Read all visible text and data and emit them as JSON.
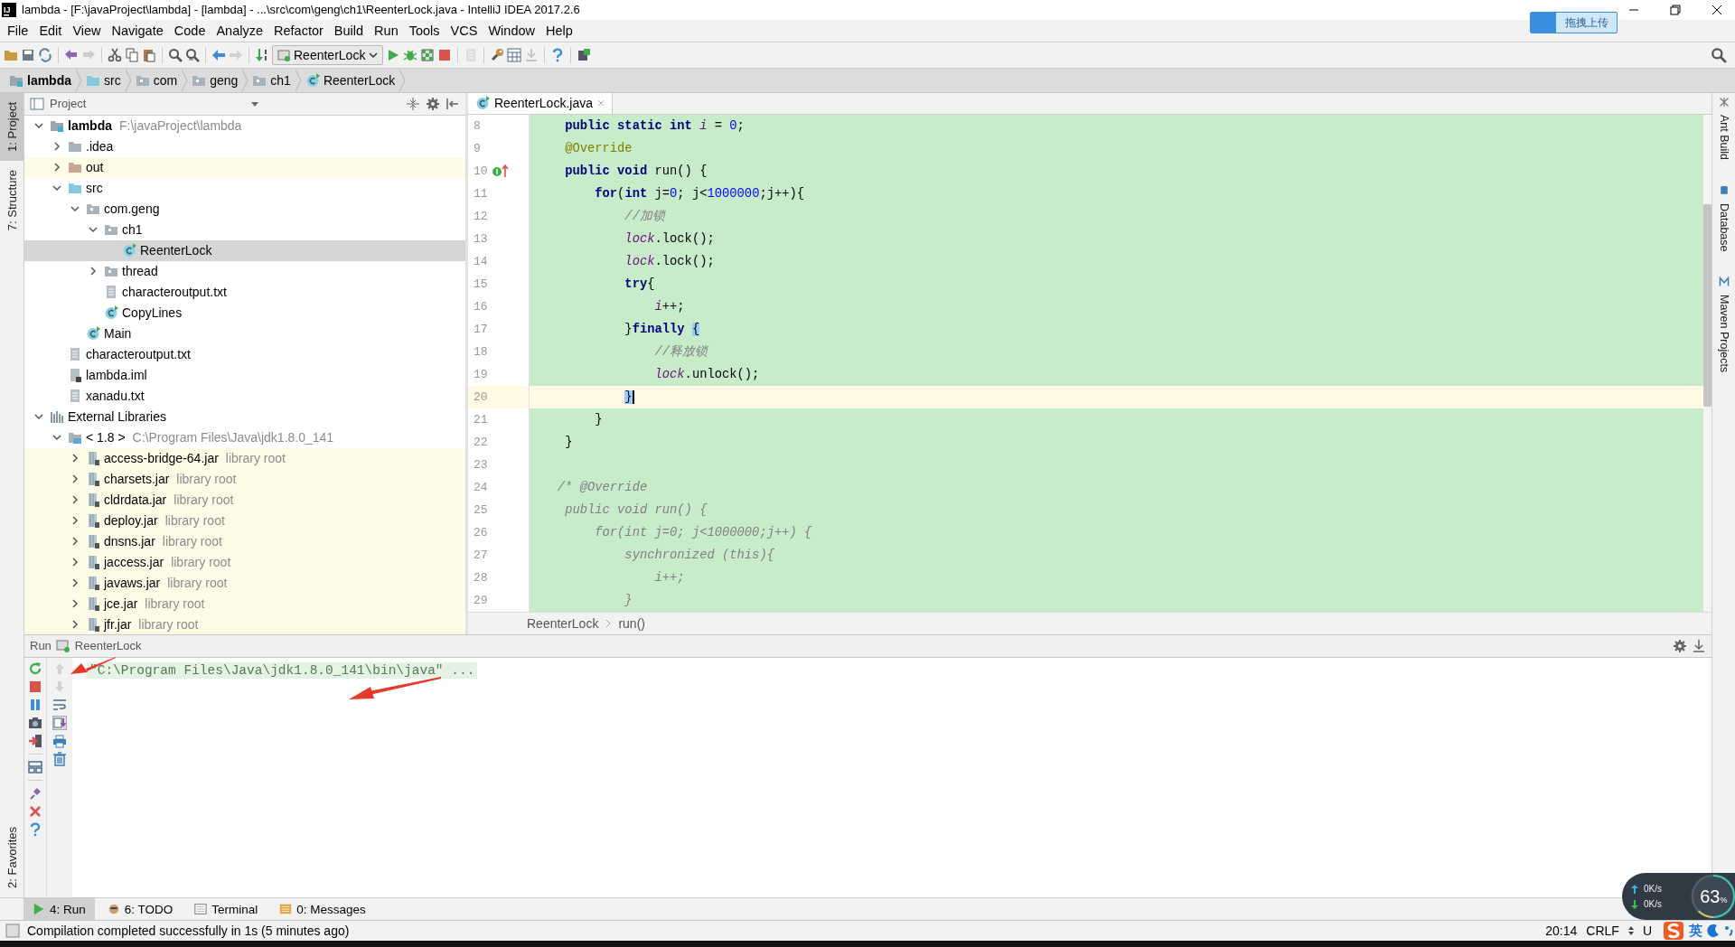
{
  "window": {
    "app_logo": "IJ",
    "title": "lambda - [F:\\javaProject\\lambda] - [lambda] - ...\\src\\com\\geng\\ch1\\ReenterLock.java - IntelliJ IDEA 2017.2.6"
  },
  "upload_widget": {
    "label": "拖拽上传"
  },
  "menu": [
    "File",
    "Edit",
    "View",
    "Navigate",
    "Code",
    "Analyze",
    "Refactor",
    "Build",
    "Run",
    "Tools",
    "VCS",
    "Window",
    "Help"
  ],
  "toolbar": [
    {
      "kind": "open",
      "disabled": false
    },
    {
      "kind": "save",
      "disabled": false
    },
    {
      "kind": "sync",
      "disabled": false
    },
    {
      "kind": "separator"
    },
    {
      "kind": "undo",
      "disabled": false
    },
    {
      "kind": "redo",
      "disabled": true
    },
    {
      "kind": "separator"
    },
    {
      "kind": "cut",
      "disabled": false
    },
    {
      "kind": "copy",
      "disabled": false
    },
    {
      "kind": "paste",
      "disabled": false
    },
    {
      "kind": "separator"
    },
    {
      "kind": "find",
      "disabled": false
    },
    {
      "kind": "replace",
      "disabled": false
    },
    {
      "kind": "separator"
    },
    {
      "kind": "back",
      "disabled": false
    },
    {
      "kind": "forward",
      "disabled": true
    },
    {
      "kind": "separator"
    },
    {
      "kind": "make",
      "disabled": false
    },
    {
      "kind": "run-config",
      "label": "ReenterLock"
    },
    {
      "kind": "run",
      "disabled": false
    },
    {
      "kind": "debug",
      "disabled": false
    },
    {
      "kind": "coverage",
      "disabled": false
    },
    {
      "kind": "stop",
      "disabled": false
    },
    {
      "kind": "separator"
    },
    {
      "kind": "document",
      "disabled": true
    },
    {
      "kind": "separator"
    },
    {
      "kind": "settings",
      "disabled": false
    },
    {
      "kind": "structure",
      "disabled": false
    },
    {
      "kind": "download",
      "disabled": true
    },
    {
      "kind": "separator"
    },
    {
      "kind": "help",
      "disabled": false
    },
    {
      "kind": "separator"
    },
    {
      "kind": "sdk",
      "disabled": false
    }
  ],
  "nav_bar": [
    {
      "label": "lambda",
      "kind": "module"
    },
    {
      "label": "src",
      "kind": "source"
    },
    {
      "label": "com",
      "kind": "package"
    },
    {
      "label": "geng",
      "kind": "package"
    },
    {
      "label": "ch1",
      "kind": "package"
    },
    {
      "label": "ReenterLock",
      "kind": "class"
    }
  ],
  "left_stripe": [
    {
      "label": "1: Project",
      "selected": true
    },
    {
      "label": "7: Structure",
      "selected": false
    }
  ],
  "left_stripe_bottom": [
    {
      "label": "2: Favorites",
      "selected": false
    }
  ],
  "right_stripe": [
    {
      "label": "Ant Build"
    },
    {
      "label": "Database"
    },
    {
      "label": "Maven Projects"
    }
  ],
  "project": {
    "title": "Project",
    "tree": [
      {
        "label": "lambda",
        "kind": "module",
        "hint": "F:\\javaProject\\lambda",
        "expanded": true,
        "selected": false,
        "children": [
          {
            "label": ".idea",
            "kind": "folder",
            "expanded": false,
            "selected": false
          },
          {
            "label": "out",
            "kind": "excluded",
            "expanded": false,
            "selected": false
          },
          {
            "label": "src",
            "kind": "source",
            "expanded": true,
            "selected": false,
            "children": [
              {
                "label": "com.geng",
                "kind": "package",
                "expanded": true,
                "selected": false,
                "children": [
                  {
                    "label": "ch1",
                    "kind": "package",
                    "expanded": true,
                    "selected": false,
                    "children": [
                      {
                        "label": "ReenterLock",
                        "kind": "class",
                        "selected": true
                      }
                    ]
                  },
                  {
                    "label": "thread",
                    "kind": "package",
                    "expanded": false,
                    "selected": false
                  },
                  {
                    "label": "characteroutput.txt",
                    "kind": "text",
                    "selected": false
                  },
                  {
                    "label": "CopyLines",
                    "kind": "class",
                    "selected": false
                  }
                ]
              },
              {
                "label": "Main",
                "kind": "class",
                "selected": false
              }
            ]
          },
          {
            "label": "characteroutput.txt",
            "kind": "text",
            "selected": false
          },
          {
            "label": "lambda.iml",
            "kind": "iml",
            "selected": false
          },
          {
            "label": "xanadu.txt",
            "kind": "text",
            "selected": false
          }
        ]
      },
      {
        "label": "External Libraries",
        "kind": "libraries",
        "expanded": true,
        "selected": false,
        "children": [
          {
            "label": "< 1.8 >",
            "kind": "sdk",
            "hint": "C:\\Program Files\\Java\\jdk1.8.0_141",
            "expanded": true,
            "selected": false,
            "children": [
              {
                "label": "access-bridge-64.jar",
                "kind": "jar",
                "hint": "library root",
                "expanded": false,
                "selected": false
              },
              {
                "label": "charsets.jar",
                "kind": "jar",
                "hint": "library root",
                "expanded": false,
                "selected": false
              },
              {
                "label": "cldrdata.jar",
                "kind": "jar",
                "hint": "library root",
                "expanded": false,
                "selected": false
              },
              {
                "label": "deploy.jar",
                "kind": "jar",
                "hint": "library root",
                "expanded": false,
                "selected": false
              },
              {
                "label": "dnsns.jar",
                "kind": "jar",
                "hint": "library root",
                "expanded": false,
                "selected": false
              },
              {
                "label": "jaccess.jar",
                "kind": "jar",
                "hint": "library root",
                "expanded": false,
                "selected": false
              },
              {
                "label": "javaws.jar",
                "kind": "jar",
                "hint": "library root",
                "expanded": false,
                "selected": false
              },
              {
                "label": "jce.jar",
                "kind": "jar",
                "hint": "library root",
                "expanded": false,
                "selected": false
              },
              {
                "label": "jfr.jar",
                "kind": "jar",
                "hint": "library root",
                "expanded": false,
                "selected": false
              }
            ]
          }
        ]
      }
    ]
  },
  "editor": {
    "tabs": [
      {
        "label": "ReenterLock.java",
        "selected": true
      }
    ],
    "lines": [
      {
        "number": "8",
        "current": false,
        "tokens": [
          {
            "text": "    public",
            "kind": "keyword"
          },
          {
            "text": " static",
            "kind": "keyword"
          },
          {
            "text": " int",
            "kind": "keyword"
          },
          {
            "text": " i",
            "kind": "static"
          },
          {
            "text": " = ",
            "kind": "plain"
          },
          {
            "text": "0",
            "kind": "number"
          },
          {
            "text": ";",
            "kind": "plain"
          }
        ]
      },
      {
        "number": "9",
        "current": false,
        "tokens": [
          {
            "text": "    @Override",
            "kind": "annotation"
          }
        ]
      },
      {
        "number": "10",
        "current": false,
        "kind": "override",
        "tokens": [
          {
            "text": "    public",
            "kind": "keyword"
          },
          {
            "text": " void",
            "kind": "keyword"
          },
          {
            "text": " run() {",
            "kind": "plain"
          }
        ]
      },
      {
        "number": "11",
        "current": false,
        "tokens": [
          {
            "text": "        for",
            "kind": "keyword"
          },
          {
            "text": "(",
            "kind": "plain"
          },
          {
            "text": "int",
            "kind": "keyword"
          },
          {
            "text": " j=",
            "kind": "plain"
          },
          {
            "text": "0",
            "kind": "number"
          },
          {
            "text": "; j<",
            "kind": "plain"
          },
          {
            "text": "1000000",
            "kind": "number"
          },
          {
            "text": ";j++){",
            "kind": "plain"
          }
        ]
      },
      {
        "number": "12",
        "current": false,
        "tokens": [
          {
            "text": "            //加锁",
            "kind": "comment"
          }
        ]
      },
      {
        "number": "13",
        "current": false,
        "tokens": [
          {
            "text": "            lock",
            "kind": "static"
          },
          {
            "text": ".lock();",
            "kind": "plain"
          }
        ]
      },
      {
        "number": "14",
        "current": false,
        "tokens": [
          {
            "text": "            lock",
            "kind": "static"
          },
          {
            "text": ".lock();",
            "kind": "plain"
          }
        ]
      },
      {
        "number": "15",
        "current": false,
        "tokens": [
          {
            "text": "            try",
            "kind": "keyword"
          },
          {
            "text": "{",
            "kind": "plain"
          }
        ]
      },
      {
        "number": "16",
        "current": false,
        "tokens": [
          {
            "text": "                i",
            "kind": "static"
          },
          {
            "text": "++;",
            "kind": "plain"
          }
        ]
      },
      {
        "number": "17",
        "current": false,
        "tokens": [
          {
            "text": "            }",
            "kind": "plain"
          },
          {
            "text": "finally",
            "kind": "keyword"
          },
          {
            "text": " {",
            "kind": "brace-match"
          }
        ]
      },
      {
        "number": "18",
        "current": false,
        "tokens": [
          {
            "text": "                //释放锁",
            "kind": "comment"
          }
        ]
      },
      {
        "number": "19",
        "current": false,
        "tokens": [
          {
            "text": "                lock",
            "kind": "static"
          },
          {
            "text": ".unlock();",
            "kind": "plain"
          }
        ]
      },
      {
        "number": "20",
        "current": true,
        "tokens": [
          {
            "text": "            }",
            "kind": "brace-match"
          }
        ]
      },
      {
        "number": "21",
        "current": false,
        "tokens": [
          {
            "text": "        }",
            "kind": "plain"
          }
        ]
      },
      {
        "number": "22",
        "current": false,
        "tokens": [
          {
            "text": "    }",
            "kind": "plain"
          }
        ]
      },
      {
        "number": "23",
        "current": false
      },
      {
        "number": "24",
        "current": false,
        "tokens": [
          {
            "text": "   /* @Override",
            "kind": "block-comment"
          }
        ]
      },
      {
        "number": "25",
        "current": false,
        "tokens": [
          {
            "text": "    public void run() {",
            "kind": "block-comment"
          }
        ]
      },
      {
        "number": "26",
        "current": false,
        "tokens": [
          {
            "text": "        for(int j=0; j<1000000;j++) {",
            "kind": "block-comment"
          }
        ]
      },
      {
        "number": "27",
        "current": false,
        "tokens": [
          {
            "text": "            synchronized (this){",
            "kind": "block-comment"
          }
        ]
      },
      {
        "number": "28",
        "current": false,
        "tokens": [
          {
            "text": "                i++;",
            "kind": "block-comment"
          }
        ]
      },
      {
        "number": "29",
        "current": false,
        "tokens": [
          {
            "text": "            }",
            "kind": "block-comment"
          }
        ]
      }
    ],
    "breadcrumb": [
      "ReenterLock",
      "run()"
    ]
  },
  "run_panel": {
    "label": "Run",
    "config": "ReenterLock",
    "toolbar": [
      {
        "kind": "rerun",
        "disabled": false
      },
      {
        "kind": "stop",
        "disabled": false
      },
      {
        "kind": "pause",
        "disabled": false
      },
      {
        "kind": "camera",
        "disabled": false
      },
      {
        "kind": "exit",
        "disabled": false
      },
      {
        "kind": "separator"
      },
      {
        "kind": "layout",
        "disabled": false
      },
      {
        "kind": "separator"
      },
      {
        "kind": "pin",
        "disabled": false
      },
      {
        "kind": "close",
        "disabled": false
      },
      {
        "kind": "help",
        "disabled": false
      }
    ],
    "toolbar_2": [
      {
        "kind": "up",
        "disabled": true
      },
      {
        "kind": "down",
        "disabled": true
      },
      {
        "kind": "wrap",
        "disabled": false
      },
      {
        "kind": "scroll-end",
        "disabled": false
      },
      {
        "kind": "print",
        "disabled": false
      },
      {
        "kind": "trash",
        "disabled": false
      }
    ],
    "console": [
      "\"C:\\Program Files\\Java\\jdk1.8.0_141\\bin\\java\" ..."
    ]
  },
  "tool_tabs": [
    {
      "label": "4: Run",
      "kind": "run",
      "selected": true
    },
    {
      "label": "6: TODO",
      "kind": "todo",
      "selected": false
    },
    {
      "label": "Terminal",
      "kind": "terminal",
      "selected": false
    },
    {
      "label": "0: Messages",
      "kind": "messages",
      "selected": false
    }
  ],
  "status_bar": {
    "message": "Compilation completed successfully in 1s (5 minutes ago)",
    "position": "20:14",
    "line_separator": "CRLF",
    "encoding": "U"
  },
  "net_widget": {
    "upload": "0K/s",
    "download": "0K/s",
    "percent": "63",
    "unit": "%"
  },
  "ime": {
    "mode": "英"
  }
}
